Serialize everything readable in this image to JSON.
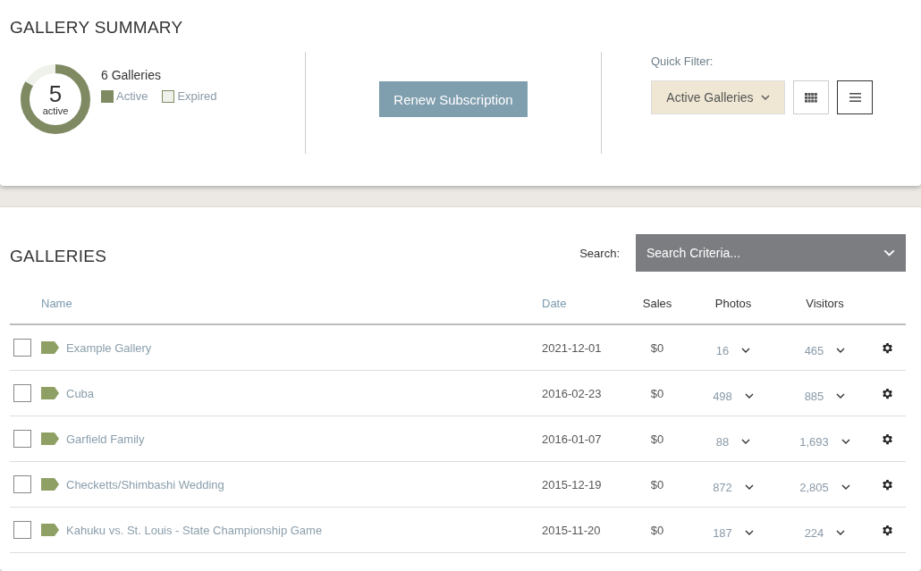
{
  "summary": {
    "title": "GALLERY SUMMARY",
    "donut": {
      "count": "5",
      "label": "active",
      "level": 0.833
    },
    "total": "6 Galleries",
    "legend": [
      {
        "label": "Active",
        "color": "#7f8a63"
      },
      {
        "label": "Expired",
        "color": "#eff2ea"
      }
    ],
    "renew_button": "Renew Subscription",
    "quick_filter": {
      "label": "Quick Filter:",
      "value": "Active Galleries"
    },
    "views": [
      {
        "kind": "grid",
        "selected": false
      },
      {
        "kind": "list",
        "selected": true
      }
    ]
  },
  "galleries": {
    "title": "GALLERIES",
    "search": {
      "label": "Search:",
      "placeholder": "Search Criteria..."
    },
    "columns": [
      {
        "label": "Name",
        "sortable": true
      },
      {
        "label": "Date",
        "sortable": true
      },
      {
        "label": "Sales",
        "sortable": false
      },
      {
        "label": "Photos",
        "sortable": false
      },
      {
        "label": "Visitors",
        "sortable": false
      }
    ],
    "rows": [
      {
        "checked": false,
        "name": "Example Gallery",
        "date": "2021-12-01",
        "sales": "$0",
        "photos": "16",
        "visitors": "465"
      },
      {
        "checked": false,
        "name": "Cuba",
        "date": "2016-02-23",
        "sales": "$0",
        "photos": "498",
        "visitors": "885"
      },
      {
        "checked": false,
        "name": "Garfield Family",
        "date": "2016-01-07",
        "sales": "$0",
        "photos": "88",
        "visitors": "1,693"
      },
      {
        "checked": false,
        "name": "Checketts/Shimbashi Wedding",
        "date": "2015-12-19",
        "sales": "$0",
        "photos": "872",
        "visitors": "2,805"
      },
      {
        "checked": false,
        "name": "Kahuku vs. St. Louis - State Championship Game",
        "date": "2015-11-20",
        "sales": "$0",
        "photos": "187",
        "visitors": "224"
      }
    ]
  }
}
